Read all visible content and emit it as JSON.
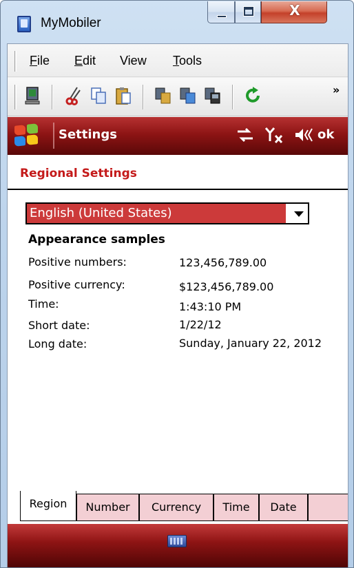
{
  "window": {
    "title": "MyMobiler",
    "close_glyph": "X"
  },
  "menu": {
    "items": [
      {
        "accel": "F",
        "rest": "ile"
      },
      {
        "accel": "E",
        "rest": "dit"
      },
      {
        "accel": "",
        "rest": "View"
      },
      {
        "accel": "T",
        "rest": "ools"
      }
    ]
  },
  "toolbar": {
    "overflow": "»"
  },
  "device": {
    "title": "Settings",
    "ok_label": "ok",
    "status_icons": "⇄ Ƴ ◀"
  },
  "settings": {
    "section_title": "Regional Settings",
    "locale_selected": "English (United States)",
    "samples_title": "Appearance samples",
    "samples": [
      {
        "label": "Positive numbers:",
        "value": "123,456,789.00"
      },
      {
        "label": "Positive currency:",
        "value": "$123,456,789.00"
      },
      {
        "label": "Time:",
        "value": "1:43:10 PM"
      },
      {
        "label": "Short date:",
        "value": "1/22/12"
      },
      {
        "label": "Long date:",
        "value": "Sunday, January 22, 2012"
      }
    ]
  },
  "tabs": [
    "Region",
    "Number",
    "Currency",
    "Time",
    "Date"
  ],
  "active_tab": "Region",
  "colors": {
    "accent_red": "#c41a1a",
    "selection_red": "#cc3a3a",
    "tab_pink": "#f3cfd4"
  }
}
